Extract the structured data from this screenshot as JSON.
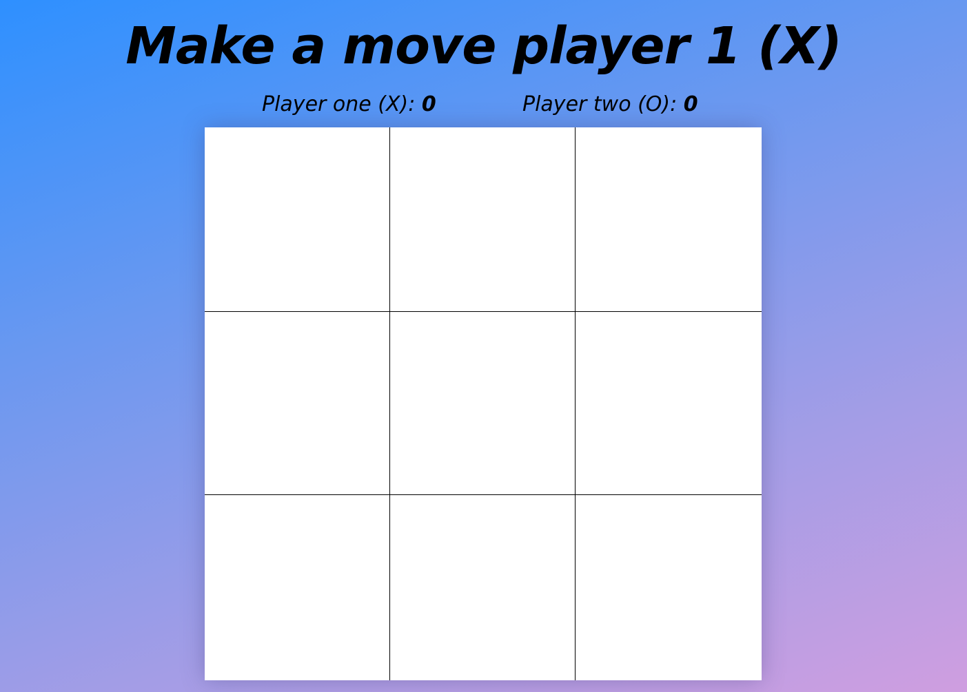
{
  "heading": "Make a move player 1 (X)",
  "scoreboard": {
    "player_one_label": "Player one (X): ",
    "player_one_score": "0",
    "player_two_label": "Player two (O): ",
    "player_two_score": "0"
  },
  "board": {
    "cells": [
      "",
      "",
      "",
      "",
      "",
      "",
      "",
      "",
      ""
    ]
  },
  "colors": {
    "background_start": "#2e90ff",
    "background_end": "#cf9ee0",
    "board": "#ffffff",
    "grid_lines": "#000000"
  }
}
